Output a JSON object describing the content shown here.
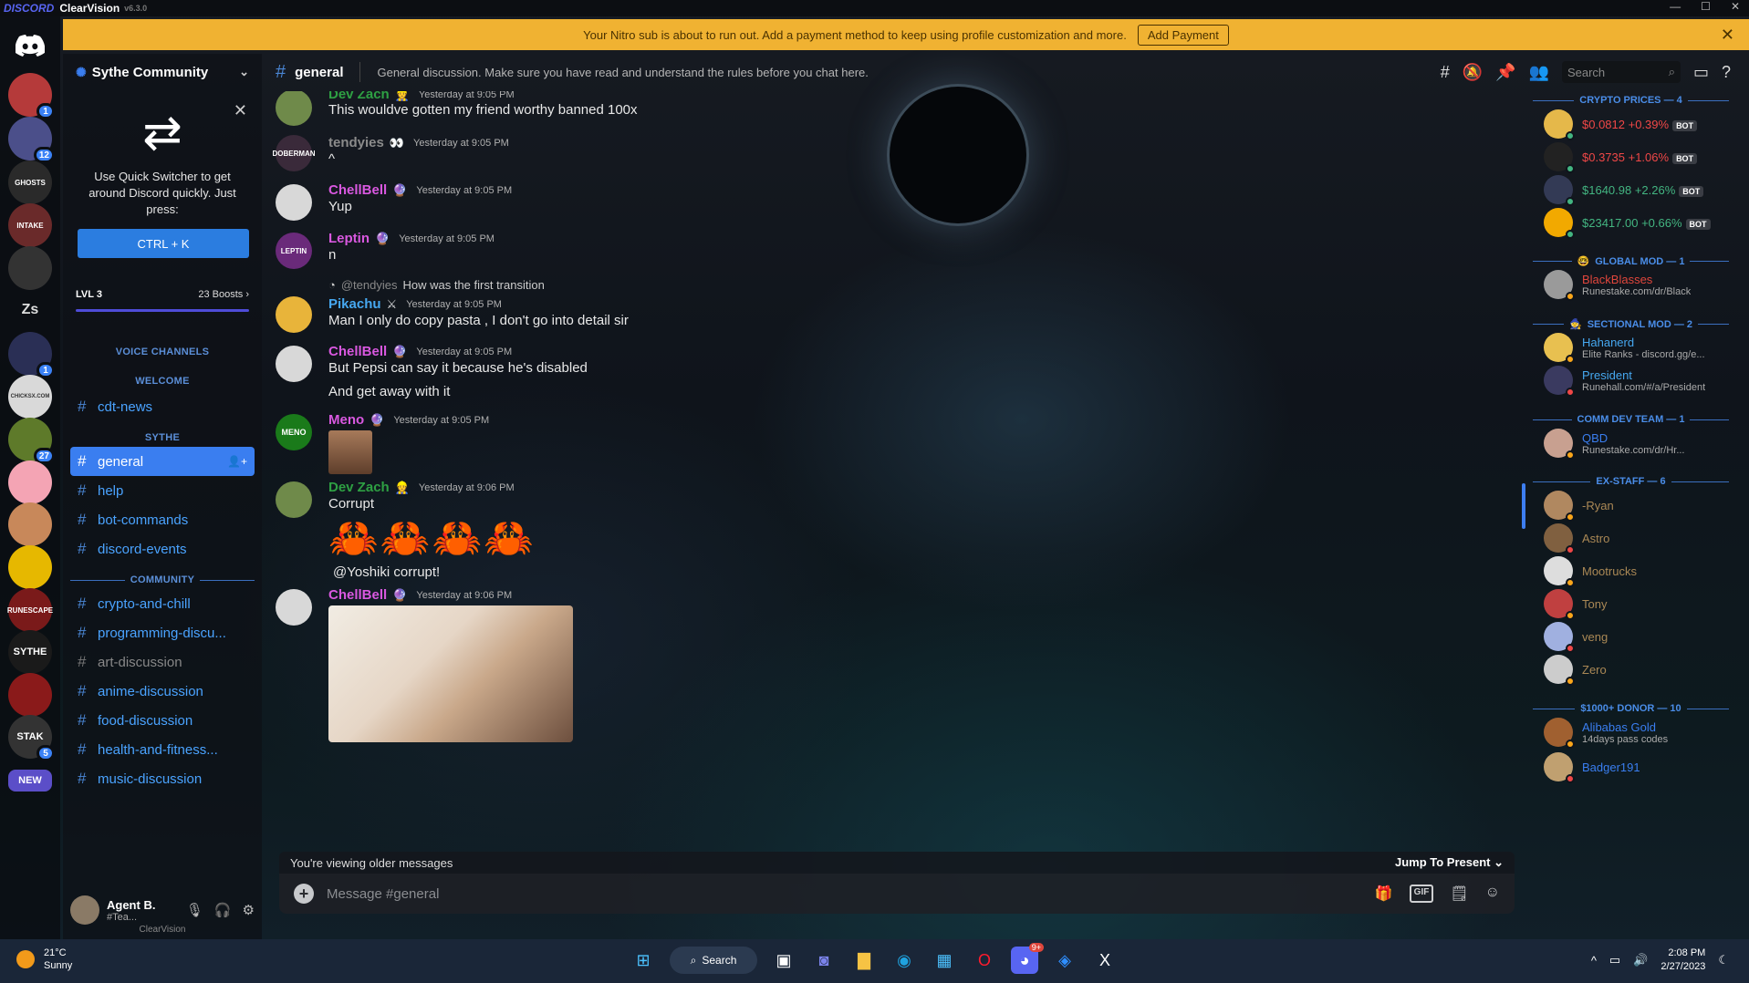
{
  "window": {
    "brand": "DISCORD",
    "app": "ClearVision",
    "version": "v6.3.0"
  },
  "banner": {
    "text": "Your Nitro sub is about to run out. Add a payment method to keep using profile customization and more.",
    "button": "Add Payment"
  },
  "servers": [
    {
      "label": "",
      "badge": "1",
      "color": "#b53a3a"
    },
    {
      "label": "",
      "badge": "12",
      "color": "#4b4f8a"
    },
    {
      "label": "GHOSTS",
      "badge": "",
      "color": "#2a2a2a"
    },
    {
      "label": "INTAKE",
      "badge": "",
      "color": "#6a2a2a"
    },
    {
      "label": "",
      "badge": "",
      "color": "#333"
    },
    {
      "label": "Zs",
      "badge": "",
      "color": "transparent"
    },
    {
      "label": "",
      "badge": "1",
      "color": "#2a2f55"
    },
    {
      "label": "CHICKSX.COM",
      "badge": "",
      "color": "#d9d9d9"
    },
    {
      "label": "",
      "badge": "27",
      "color": "#5e7a2a"
    },
    {
      "label": "",
      "badge": "",
      "color": "#f4a4b4"
    },
    {
      "label": "",
      "badge": "",
      "color": "#c8885a"
    },
    {
      "label": "",
      "badge": "",
      "color": "#e6b800"
    },
    {
      "label": "RUNESCAPE",
      "badge": "",
      "color": "#7a1a1a"
    },
    {
      "label": "SYTHE",
      "badge": "",
      "color": "#1a1a1a"
    },
    {
      "label": "",
      "badge": "",
      "color": "#8a1a1a"
    },
    {
      "label": "STAK",
      "badge": "5",
      "color": "#333"
    },
    {
      "label": "NEW",
      "badge": "",
      "color": "#5b4ec8"
    }
  ],
  "sidebar": {
    "server_name": "Sythe Community",
    "quick_switcher": {
      "text": "Use Quick Switcher to get around Discord quickly. Just press:",
      "button": "CTRL + K"
    },
    "boost": {
      "level": "LVL 3",
      "count": "23 Boosts",
      "fill": 1.0
    },
    "categories": {
      "voice": "VOICE CHANNELS",
      "welcome": "WELCOME",
      "sythe": "SYTHE",
      "community": "COMMUNITY"
    },
    "welcome_channels": [
      "cdt-news"
    ],
    "sythe_channels": [
      "general",
      "help",
      "bot-commands",
      "discord-events"
    ],
    "community_channels": [
      "crypto-and-chill",
      "programming-discu...",
      "art-discussion",
      "anime-discussion",
      "food-discussion",
      "health-and-fitness...",
      "music-discussion"
    ]
  },
  "user": {
    "name": "Agent B.",
    "status": "#Tea...",
    "client": "ClearVision"
  },
  "chat": {
    "channel": "general",
    "topic": "General discussion. Make sure you have read and understand the rules before you chat here.",
    "search_placeholder": "Search",
    "messages": [
      {
        "author": "Dev Zach",
        "color": "#2ea043",
        "time": "Yesterday at 9:05 PM",
        "text": "This wouldve gotten my friend worthy banned 100x"
      },
      {
        "author": "tendyies",
        "color": "#8b8b8b",
        "time": "Yesterday at 9:05 PM",
        "text": "^"
      },
      {
        "author": "ChellBell",
        "color": "#d958e0",
        "time": "Yesterday at 9:05 PM",
        "text": "Yup"
      },
      {
        "author": "Leptin",
        "color": "#d958e0",
        "time": "Yesterday at 9:05 PM",
        "text": "n"
      },
      {
        "author": "Pikachu",
        "color": "#46a8f0",
        "time": "Yesterday at 9:05 PM",
        "text": "Man I only do copy pasta , I don't go into detail sir",
        "reply_to": "@tendyies",
        "reply_text": "How was the first transition"
      },
      {
        "author": "ChellBell",
        "color": "#d958e0",
        "time": "Yesterday at 9:05 PM",
        "text": "But Pepsi can say it because he's disabled",
        "text2": "And get away with it"
      },
      {
        "author": "Meno",
        "color": "#d958e0",
        "time": "Yesterday at 9:05 PM",
        "text": ""
      },
      {
        "author": "Dev Zach",
        "color": "#2ea043",
        "time": "Yesterday at 9:06 PM",
        "text": "Corrupt",
        "text2": "@Yoshiki  corrupt!"
      },
      {
        "author": "ChellBell",
        "color": "#d958e0",
        "time": "Yesterday at 9:06 PM",
        "text": ""
      }
    ],
    "older_notice": "You're viewing older messages",
    "jump": "Jump To Present",
    "composer_placeholder": "Message #general",
    "gif_label": "GIF"
  },
  "members": {
    "categories": [
      {
        "label": "CRYPTO PRICES — 4"
      },
      {
        "label": "GLOBAL MOD — 1"
      },
      {
        "label": "SECTIONAL MOD — 2"
      },
      {
        "label": "COMM DEV TEAM — 1"
      },
      {
        "label": "EX-STAFF — 6"
      },
      {
        "label": "$1000+ DONOR — 10"
      }
    ],
    "list": [
      {
        "name": "$0.0812 +0.39%",
        "sub": "",
        "color": "#f04747",
        "bot": "BOT",
        "av": "#e5b84a"
      },
      {
        "name": "$0.3735 +1.06%",
        "sub": "",
        "color": "#f04747",
        "bot": "BOT",
        "av": "#222"
      },
      {
        "name": "$1640.98 +2.26%",
        "sub": "",
        "color": "#43b581",
        "bot": "BOT",
        "av": "#333a55"
      },
      {
        "name": "$23417.00 +0.66%",
        "sub": "",
        "color": "#43b581",
        "bot": "BOT",
        "av": "#f2a900"
      },
      {
        "name": "BlackBlasses",
        "sub": "Runestake.com/dr/Black",
        "color": "#e0463c",
        "bot": "",
        "av": "#9a9a9a"
      },
      {
        "name": "Hahanerd",
        "sub": "Elite Ranks - discord.gg/e...",
        "color": "#46a8f0",
        "bot": "",
        "av": "#e8c050"
      },
      {
        "name": "President",
        "sub": "Runehall.com/#/a/President",
        "color": "#46a8f0",
        "bot": "",
        "av": "#3a3a60"
      },
      {
        "name": "QBD",
        "sub": "Runestake.com/dr/Hr...",
        "color": "#3a7ef0",
        "bot": "",
        "av": "#c8a090"
      },
      {
        "name": "-Ryan",
        "sub": "",
        "color": "#aa8855",
        "bot": "",
        "av": "#b08860"
      },
      {
        "name": "Astro",
        "sub": "",
        "color": "#aa8855",
        "bot": "",
        "av": "#806040"
      },
      {
        "name": "Mootrucks",
        "sub": "",
        "color": "#aa8855",
        "bot": "",
        "av": "#ddd"
      },
      {
        "name": "Tony",
        "sub": "",
        "color": "#aa8855",
        "bot": "",
        "av": "#c04040"
      },
      {
        "name": "veng",
        "sub": "",
        "color": "#aa8855",
        "bot": "",
        "av": "#a0b0e0"
      },
      {
        "name": "Zero",
        "sub": "",
        "color": "#aa8855",
        "bot": "",
        "av": "#cccccc"
      },
      {
        "name": "Alibabas Gold",
        "sub": "14days pass codes",
        "color": "#3a7ef0",
        "bot": "",
        "av": "#a06030"
      },
      {
        "name": "Badger191",
        "sub": "",
        "color": "#3a7ef0",
        "bot": "",
        "av": "#c0a070"
      }
    ]
  },
  "taskbar": {
    "temp": "21°C",
    "weather": "Sunny",
    "search": "Search",
    "time": "2:08 PM",
    "date": "2/27/2023",
    "discord_badge": "9+"
  }
}
